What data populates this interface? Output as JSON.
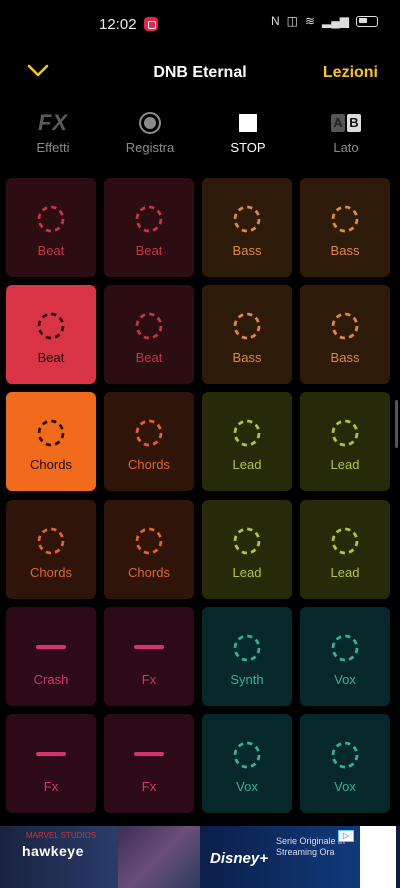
{
  "status_bar": {
    "time": "12:02",
    "icons": [
      "nfc-icon",
      "vibrate-icon",
      "wifi-icon",
      "signal-icon",
      "battery-icon"
    ]
  },
  "header": {
    "title": "DNB Eternal",
    "lessons_label": "Lezioni",
    "accent_color": "#f5c518"
  },
  "tools": [
    {
      "icon_text": "FX",
      "label": "Effetti"
    },
    {
      "icon": "record-icon",
      "label": "Registra"
    },
    {
      "icon": "stop-icon",
      "label": "STOP"
    },
    {
      "icon_a": "A",
      "icon_b": "B",
      "label": "Lato"
    }
  ],
  "pads": [
    {
      "label": "Beat",
      "bg": "#2c0d12",
      "fg": "#c8324a",
      "shape": "ring",
      "active": false
    },
    {
      "label": "Beat",
      "bg": "#2c0d12",
      "fg": "#c8324a",
      "shape": "ring",
      "active": false
    },
    {
      "label": "Bass",
      "bg": "#2e1a08",
      "fg": "#e08a3a",
      "shape": "ring",
      "active": false
    },
    {
      "label": "Bass",
      "bg": "#2e1a08",
      "fg": "#e08a3a",
      "shape": "ring",
      "active": false
    },
    {
      "label": "Beat",
      "bg": "#d93445",
      "fg": "#2a0a0f",
      "shape": "ring",
      "active": true
    },
    {
      "label": "Beat",
      "bg": "#2c0d12",
      "fg": "#c8324a",
      "shape": "ring",
      "active": false
    },
    {
      "label": "Bass",
      "bg": "#2e1a08",
      "fg": "#e08a3a",
      "shape": "ring",
      "active": false
    },
    {
      "label": "Bass",
      "bg": "#2e1a08",
      "fg": "#e08a3a",
      "shape": "ring",
      "active": false
    },
    {
      "label": "Chords",
      "bg": "#f26a1b",
      "fg": "#2a1205",
      "shape": "ring",
      "active": true
    },
    {
      "label": "Chords",
      "bg": "#2e1409",
      "fg": "#e4632a",
      "shape": "ring",
      "active": false
    },
    {
      "label": "Lead",
      "bg": "#262a08",
      "fg": "#b6c43c",
      "shape": "ring",
      "active": false
    },
    {
      "label": "Lead",
      "bg": "#262a08",
      "fg": "#b6c43c",
      "shape": "ring",
      "active": false
    },
    {
      "label": "Chords",
      "bg": "#2e1409",
      "fg": "#e4632a",
      "shape": "ring",
      "active": false
    },
    {
      "label": "Chords",
      "bg": "#2e1409",
      "fg": "#e4632a",
      "shape": "ring",
      "active": false
    },
    {
      "label": "Lead",
      "bg": "#262a08",
      "fg": "#b6c43c",
      "shape": "ring",
      "active": false
    },
    {
      "label": "Lead",
      "bg": "#262a08",
      "fg": "#b6c43c",
      "shape": "ring",
      "active": false
    },
    {
      "label": "Crash",
      "bg": "#2c0a18",
      "fg": "#d8336a",
      "shape": "dash",
      "active": false
    },
    {
      "label": "Fx",
      "bg": "#2c0a18",
      "fg": "#d8336a",
      "shape": "dash",
      "active": false
    },
    {
      "label": "Synth",
      "bg": "#06282a",
      "fg": "#2fb39a",
      "shape": "ring",
      "active": false
    },
    {
      "label": "Vox",
      "bg": "#06282a",
      "fg": "#2fb39a",
      "shape": "ring",
      "active": false
    },
    {
      "label": "Fx",
      "bg": "#2c0a18",
      "fg": "#d8336a",
      "shape": "dash",
      "active": false
    },
    {
      "label": "Fx",
      "bg": "#2c0a18",
      "fg": "#d8336a",
      "shape": "dash",
      "active": false
    },
    {
      "label": "Vox",
      "bg": "#06282a",
      "fg": "#2fb39a",
      "shape": "ring",
      "active": false
    },
    {
      "label": "Vox",
      "bg": "#06282a",
      "fg": "#2fb39a",
      "shape": "ring",
      "active": false
    }
  ],
  "ad": {
    "left_text": "hawkeye",
    "small_text": "MARVEL STUDIOS",
    "brand": "Disney+",
    "tagline": "Serie Originale in Streaming Ora"
  }
}
